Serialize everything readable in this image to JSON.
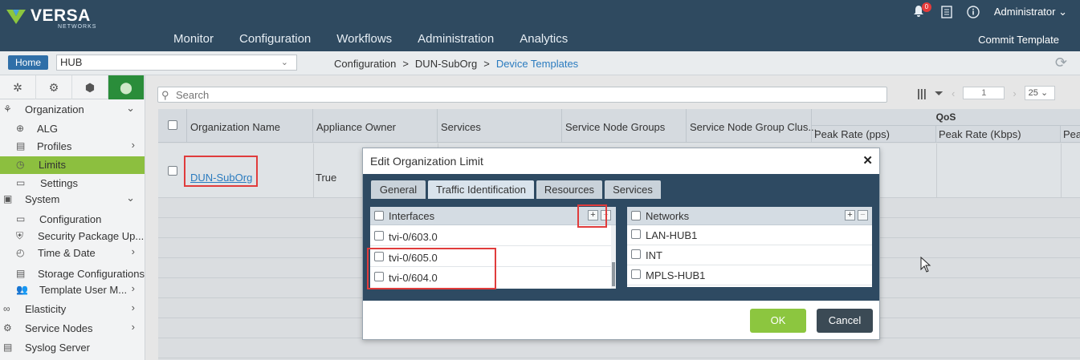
{
  "brand": {
    "name": "VERSA",
    "sub": "NETWORKS"
  },
  "topnav": [
    "Monitor",
    "Configuration",
    "Workflows",
    "Administration",
    "Analytics"
  ],
  "header": {
    "commit": "Commit Template",
    "notifications": "0",
    "user": "Administrator"
  },
  "crumbbar": {
    "home": "Home",
    "appliance": "HUB",
    "crumbs": [
      "Configuration",
      "DUN-SubOrg",
      "Device Templates"
    ]
  },
  "sidebar": {
    "items": [
      {
        "label": "Organization",
        "icon": "org-icon",
        "chevron": "down"
      },
      {
        "label": "ALG",
        "icon": "alg-icon"
      },
      {
        "label": "Profiles",
        "icon": "profiles-icon",
        "chevron": "right"
      },
      {
        "label": "Limits",
        "icon": "limits-icon",
        "selected": true
      },
      {
        "label": "Settings",
        "icon": "settings-icon"
      },
      {
        "label": "System",
        "icon": "system-icon",
        "chevron": "down"
      },
      {
        "label": "Configuration",
        "icon": "configuration-icon"
      },
      {
        "label": "Security Package Up...",
        "icon": "security-package-icon"
      },
      {
        "label": "Time & Date",
        "icon": "clock-icon",
        "chevron": "right"
      },
      {
        "label": "Storage Configurations",
        "icon": "storage-icon"
      },
      {
        "label": "Template User M...",
        "icon": "users-icon",
        "chevron": "right"
      },
      {
        "label": "Elasticity",
        "icon": "elasticity-icon",
        "chevron": "right"
      },
      {
        "label": "Service Nodes",
        "icon": "service-nodes-icon",
        "chevron": "right"
      },
      {
        "label": "Syslog Server",
        "icon": "syslog-icon"
      }
    ]
  },
  "search": {
    "placeholder": "Search"
  },
  "pager": {
    "page": "1",
    "per_page": "25"
  },
  "grid": {
    "columns": [
      "Organization Name",
      "Appliance Owner",
      "Services",
      "Service Node Groups",
      "Service Node Group Clus..."
    ],
    "qos_group": "QoS",
    "qos_columns": [
      "Peak Rate (pps)",
      "Peak Rate (Kbps)",
      "Pea"
    ],
    "rows": [
      {
        "org": "DUN-SubOrg",
        "owner": "True"
      }
    ]
  },
  "modal": {
    "title": "Edit Organization Limit",
    "tabs": [
      "General",
      "Traffic Identification",
      "Resources",
      "Services"
    ],
    "active_tab": "Traffic Identification",
    "interfaces": {
      "header": "Interfaces",
      "items": [
        "tvi-0/603.0",
        "tvi-0/605.0",
        "tvi-0/604.0"
      ]
    },
    "networks": {
      "header": "Networks",
      "items": [
        "LAN-HUB1",
        "INT",
        "MPLS-HUB1"
      ]
    },
    "ok": "OK",
    "cancel": "Cancel"
  },
  "colors": {
    "header_bg": "#2f4a60",
    "accent_green": "#8cc63f",
    "link_blue": "#2a7bbf",
    "highlight_red": "#e03c3c"
  }
}
